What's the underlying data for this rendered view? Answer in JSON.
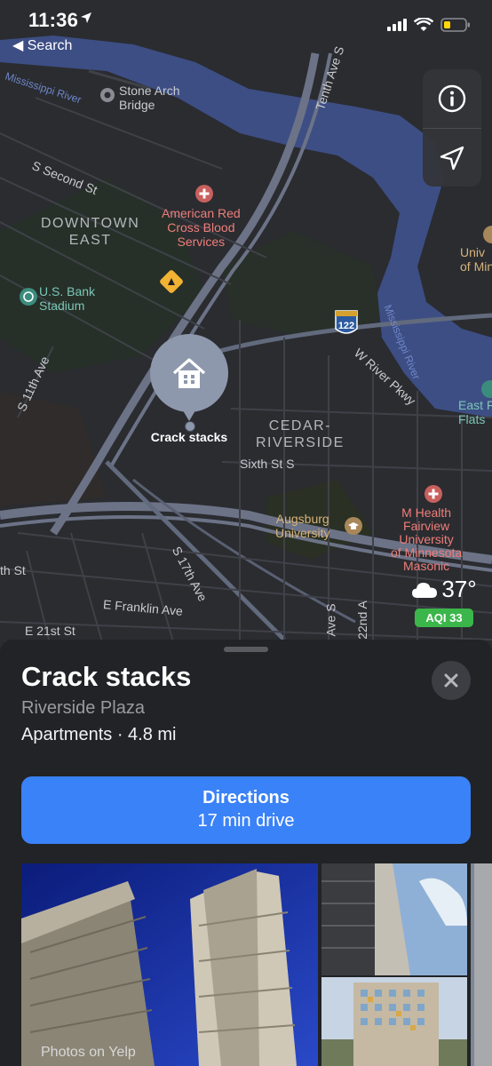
{
  "status_bar": {
    "time": "11:36",
    "back_label": "◀ Search"
  },
  "map": {
    "labels": {
      "mississippi_river": "Mississippi River",
      "stone_arch_bridge": "Stone Arch\nBridge",
      "tenth_ave": "Tenth Ave S",
      "s_second_st": "S Second St",
      "downtown_east": "DOWNTOWN\nEAST",
      "american_red_cross": "American Red\nCross Blood\nServices",
      "us_bank_stadium": "U.S. Bank\nStadium",
      "univ_of_minn": "Univ\nof Minn",
      "mississippi_river_2": "Mississippi River",
      "route_122": "122",
      "w_river_pkwy": "W River Pkwy",
      "s_11th_ave": "S 11th Ave",
      "east_flats": "East F\nFlats",
      "cedar_riverside": "CEDAR-\nRIVERSIDE",
      "sixth_st_s": "Sixth St S",
      "augsburg": "Augsburg\nUniversity",
      "m_health": "M Health\nFairview\nUniversity\nof Minnesota\nMasonic",
      "s_17th_ave": "S 17th Ave",
      "th_st": "th St",
      "e_franklin_ave": "E Franklin Ave",
      "e_21st_st": "E 21st St",
      "ave_s": "Ave S",
      "22nd_a": "22nd A"
    },
    "pin_label": "Crack stacks",
    "weather": {
      "temp": "37°",
      "aqi": "AQI 33"
    }
  },
  "place": {
    "name": "Crack stacks",
    "subtitle": "Riverside Plaza",
    "meta": "Apartments · 4.8 mi",
    "directions_label": "Directions",
    "directions_time": "17 min drive",
    "photos_credit": "Photos on Yelp"
  },
  "colors": {
    "accent": "#3a82f7",
    "aqi": "#3bb64a",
    "river": "#3d4e84",
    "pin": "#8e98ac"
  }
}
